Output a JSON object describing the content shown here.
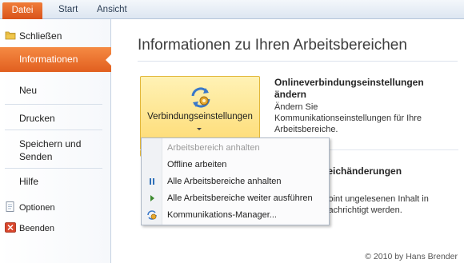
{
  "ribbon": {
    "tabs": [
      {
        "label": "Datei"
      },
      {
        "label": "Start"
      },
      {
        "label": "Ansicht"
      }
    ]
  },
  "nav": {
    "items": [
      {
        "label": "Schließen",
        "icon": "folder-close-icon"
      },
      {
        "label": "Informationen",
        "active": true
      },
      {
        "label": "Neu"
      },
      {
        "label": "Drucken"
      },
      {
        "label": "Speichern und Senden"
      },
      {
        "label": "Hilfe"
      },
      {
        "label": "Optionen",
        "icon": "document-options-icon"
      },
      {
        "label": "Beenden",
        "icon": "exit-icon"
      }
    ]
  },
  "main": {
    "title": "Informationen zu Ihren Arbeitsbereichen",
    "connection_button": {
      "label": "Verbindungseinstellungen",
      "icon": "sync-settings-icon"
    },
    "section1": {
      "heading": "Onlineverbindungseinstellungen ändern",
      "description": "Ändern Sie Kommunikationseinstellungen für Ihre Arbeitsbereiche."
    },
    "section2": {
      "heading_partial": "ereichänderungen",
      "description_partial": "von SharePoint ungelesenen Inhalt in bereich benachrichtigt werden."
    }
  },
  "dropdown": {
    "items": [
      {
        "label": "Arbeitsbereich anhalten",
        "enabled": false,
        "icon": ""
      },
      {
        "label": "Offline arbeiten",
        "enabled": true,
        "icon": ""
      },
      {
        "label": "Alle Arbeitsbereiche anhalten",
        "enabled": true,
        "icon": "pause-icon"
      },
      {
        "label": "Alle Arbeitsbereiche weiter ausführen",
        "enabled": true,
        "icon": "play-icon"
      },
      {
        "label": "Kommunikations-Manager...",
        "enabled": true,
        "icon": "communication-manager-icon"
      }
    ]
  },
  "footer": {
    "text": "© 2010 by Hans Brender"
  },
  "colors": {
    "accent": "#e2611f",
    "button_yellow": "#fde08a",
    "tab_strip": "#dde6f1"
  }
}
